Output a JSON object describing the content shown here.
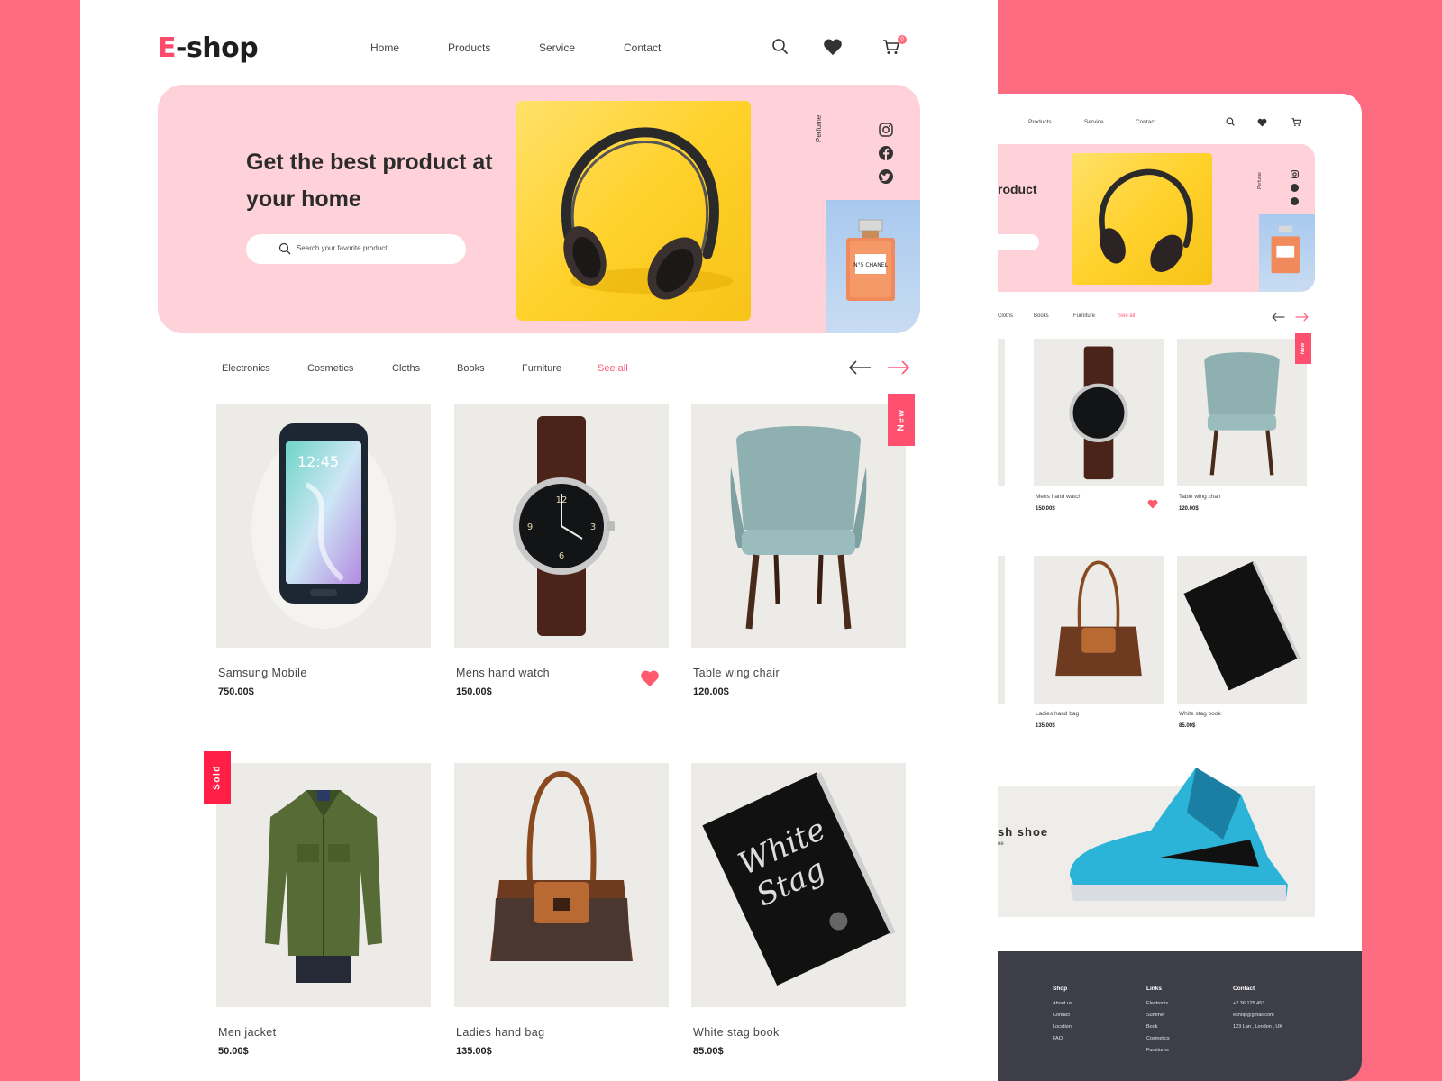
{
  "brand": {
    "logo_prefix": "E",
    "logo_rest": "-shop",
    "accent_color": "#ff4a6b",
    "background_color": "#fd6b80"
  },
  "nav": [
    "Home",
    "Products",
    "Service",
    "Contact"
  ],
  "header_icons": {
    "search": "search-icon",
    "wishlist": "heart-icon",
    "cart": "cart-icon",
    "cart_count": "0"
  },
  "hero": {
    "title": "Get the best product at your home",
    "search_placeholder": "Search your favorite product",
    "side_label": "Perfume",
    "bottle_label": "N°5 CHANEL",
    "social": [
      "instagram-icon",
      "facebook-icon",
      "twitter-icon"
    ]
  },
  "categories": [
    "Electronics",
    "Cosmetics",
    "Cloths",
    "Books",
    "Furniture"
  ],
  "see_all": "See all",
  "tags": {
    "new": "New",
    "sold": "Sold"
  },
  "products": [
    {
      "name": "Samsung Mobile",
      "price": "750.00$"
    },
    {
      "name": "Mens hand watch",
      "price": "150.00$",
      "favorited": true
    },
    {
      "name": "Table wing chair",
      "price": "120.00$",
      "tag": "New"
    },
    {
      "name": "Men jacket",
      "price": "50.00$",
      "tag": "Sold"
    },
    {
      "name": "Ladies hand bag",
      "price": "135.00$"
    },
    {
      "name": "White stag book",
      "price": "85.00$"
    }
  ],
  "book_cover": {
    "title_line1": "White",
    "title_line2": "Stag"
  },
  "secondary": {
    "nav": [
      "Products",
      "Service",
      "Contact"
    ],
    "hero_title": "roduct",
    "side_label": "Perfume",
    "categories": [
      "Cloths",
      "Books",
      "Furniture"
    ],
    "see_all": "See all",
    "tag_new": "New",
    "products": [
      {
        "name": "Mens hand watch",
        "price": "150.00$"
      },
      {
        "name": "Table wing chair",
        "price": "120.00$"
      },
      {
        "name": "Ladies hand bag",
        "price": "135.00$"
      },
      {
        "name": "White stag book",
        "price": "85.00$"
      }
    ],
    "shoe_banner": {
      "title": "sh shoe",
      "subtitle": "oe"
    },
    "footer": {
      "shop": {
        "heading": "Shop",
        "items": [
          "About us",
          "Contact",
          "Location",
          "FAQ"
        ]
      },
      "links": {
        "heading": "Links",
        "items": [
          "Electronis",
          "Summer",
          "Book",
          "Cosmetics",
          "Furnitures"
        ]
      },
      "contact": {
        "heading": "Contact",
        "items": [
          "+2 36 125 453",
          "eshop@gmail.com",
          "123 Lan , London , UK"
        ]
      }
    }
  }
}
